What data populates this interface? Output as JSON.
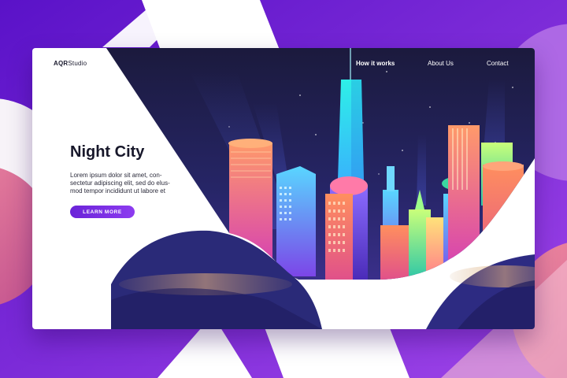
{
  "brand": {
    "logo_strong": "AQR",
    "logo_rest": "Studio"
  },
  "nav": {
    "items": [
      {
        "label": "How it works",
        "active": true
      },
      {
        "label": "About Us",
        "active": false
      },
      {
        "label": "Contact",
        "active": false
      }
    ]
  },
  "hero": {
    "title": "Night City",
    "description_lines": [
      "Lorem ipsum dolor sit amet, con-",
      "sectetur adipiscing elit, sed do elus-",
      "mod tempor incididunt ut labore et"
    ],
    "cta_label": "LEARN MORE"
  },
  "theme": {
    "accent": "#7b2ff0",
    "night_sky": "#1e1b4b",
    "hill": "#2a2a78"
  }
}
